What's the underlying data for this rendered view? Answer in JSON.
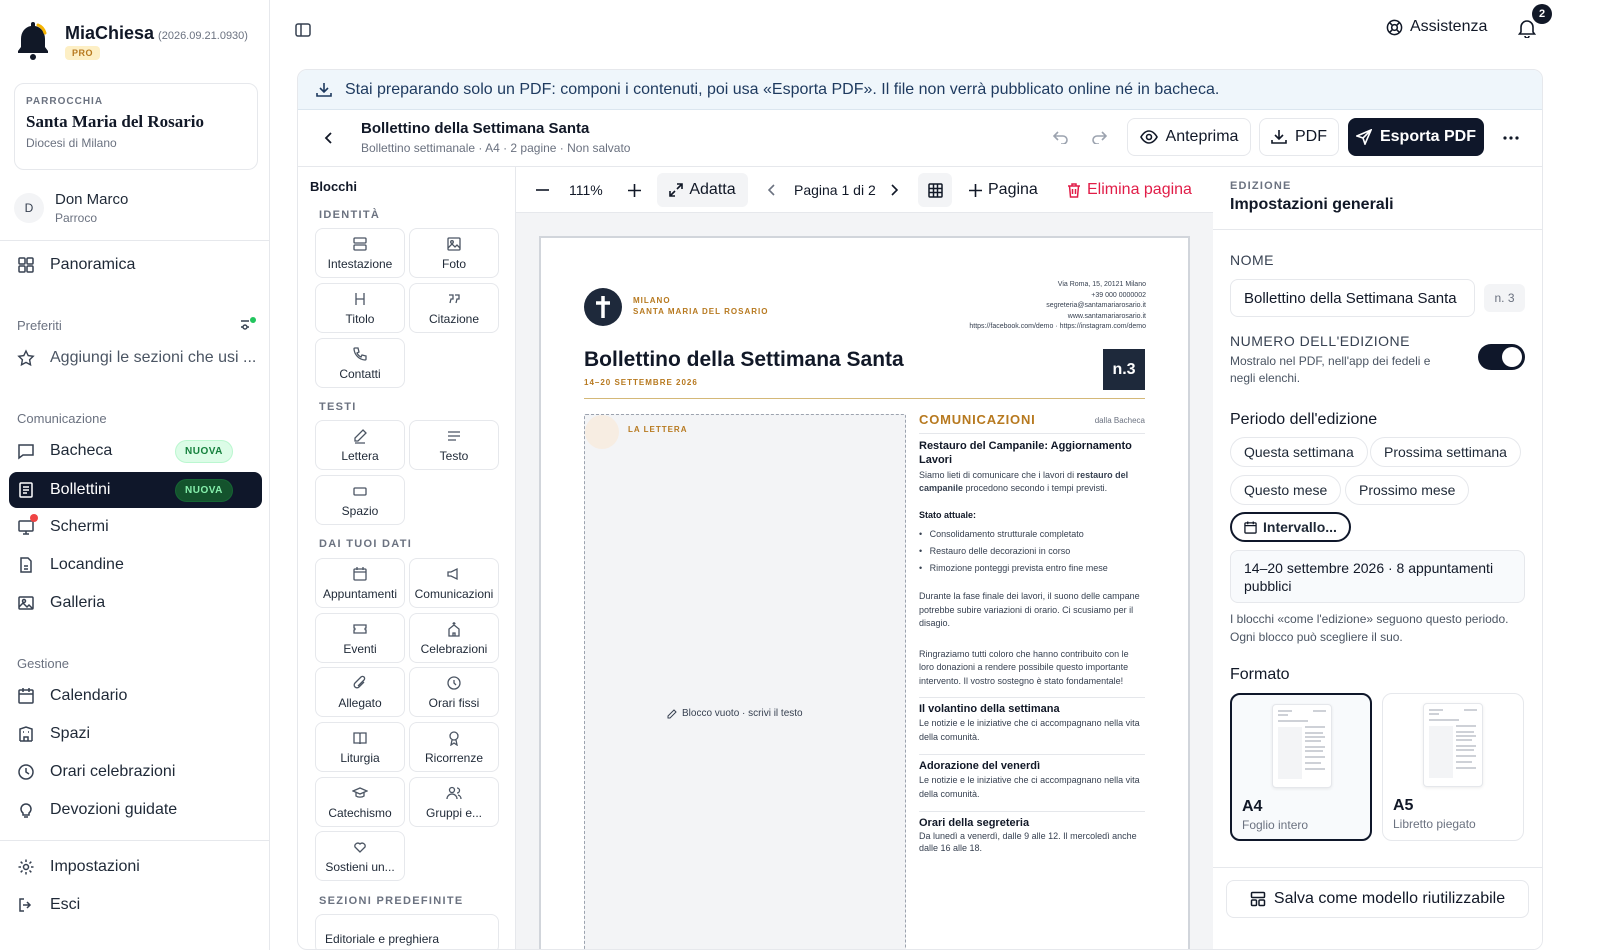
{
  "app": {
    "name": "MiaChiesa",
    "version": "(2026.09.21.0930)",
    "plan": "PRO"
  },
  "parish": {
    "kicker": "PARROCCHIA",
    "name": "Santa Maria del Rosario",
    "diocese": "Diocesi di Milano"
  },
  "user": {
    "initial": "D",
    "name": "Don Marco",
    "role": "Parroco"
  },
  "nav": {
    "overview": "Panoramica",
    "favorites_label": "Preferiti",
    "favorites_add": "Aggiungi le sezioni che usi ...",
    "comm_label": "Comunicazione",
    "comm_items": [
      {
        "label": "Bacheca",
        "badge": "NUOVA"
      },
      {
        "label": "Bollettini",
        "badge": "NUOVA"
      },
      {
        "label": "Schermi"
      },
      {
        "label": "Locandine"
      },
      {
        "label": "Galleria"
      }
    ],
    "mgmt_label": "Gestione",
    "mgmt_items": [
      "Calendario",
      "Spazi",
      "Orari celebrazioni",
      "Devozioni guidate"
    ],
    "settings": "Impostazioni",
    "logout": "Esci"
  },
  "topbar": {
    "help": "Assistenza",
    "notifications": "2"
  },
  "banner": "Stai preparando solo un PDF: componi i contenuti, poi usa «Esporta PDF». Il file non verrà pubblicato online né in bacheca.",
  "editor": {
    "title": "Bollettino della Settimana Santa",
    "meta": "Bollettino settimanale  ·  A4  ·  2 pagine  ·  Non salvato",
    "preview": "Anteprima",
    "pdf": "PDF",
    "export": "Esporta PDF"
  },
  "blocks": {
    "title": "Blocchi",
    "identity_label": "IDENTITÀ",
    "identity": [
      "Intestazione",
      "Foto",
      "Titolo",
      "Citazione",
      "Contatti"
    ],
    "texts_label": "TESTI",
    "texts": [
      "Lettera",
      "Testo",
      "Spazio"
    ],
    "data_label": "DAI TUOI DATI",
    "data": [
      "Appuntamenti",
      "Comunicazioni",
      "Eventi",
      "Celebrazioni",
      "Allegato",
      "Orari fissi",
      "Liturgia",
      "Ricorrenze",
      "Catechismo",
      "Gruppi e...",
      "Sostieni un..."
    ],
    "predef_label": "SEZIONI PREDEFINITE",
    "predef_first": "Editoriale e preghiera"
  },
  "canvas_toolbar": {
    "zoom": "111%",
    "fit": "Adatta",
    "page": "Pagina 1 di 2",
    "add_page": "Pagina",
    "delete_page": "Elimina pagina"
  },
  "document": {
    "org_city": "MILANO",
    "org_name": "SANTA MARIA DEL ROSARIO",
    "contact_lines": [
      "Via Roma, 15, 20121 Milano",
      "+39 000 0000002",
      "segreteria@santamariarosario.it",
      "www.santamariarosario.it",
      "https://facebook.com/demo · https://instagram.com/demo"
    ],
    "title": "Bollettino della Settimana Santa",
    "dates": "14–20 SETTEMBRE 2026",
    "number": "n.3",
    "letter_label": "LA LETTERA",
    "empty_block": "Blocco vuoto · scrivi il testo",
    "comm_title": "COMUNICAZIONI",
    "comm_source": "dalla Bacheca",
    "news1_title": "Restauro del Campanile: Aggiornamento Lavori",
    "news1_p1a": "Siamo lieti di comunicare che i lavori di ",
    "news1_p1b": "restauro del campanile",
    "news1_p1c": " procedono secondo i tempi previsti.",
    "status_label": "Stato attuale:",
    "status_items": [
      "Consolidamento strutturale completato",
      "Restauro delle decorazioni in corso",
      "Rimozione ponteggi prevista entro fine mese"
    ],
    "news1_p2": "Durante la fase finale dei lavori, il suono delle campane potrebbe subire variazioni di orario. Ci scusiamo per il disagio.",
    "news1_p3": "Ringraziamo tutti coloro che hanno contribuito con le loro donazioni a rendere possibile questo importante intervento. Il vostro sostegno è stato fondamentale!",
    "news2_title": "Il volantino della settimana",
    "news2_text": "Le notizie e le iniziative che ci accompagnano nella vita della comunità.",
    "news3_title": "Adorazione del venerdì",
    "news3_text": "Le notizie e le iniziative che ci accompagnano nella vita della comunità.",
    "news4_title": "Orari della segreteria",
    "news4_text": "Da lunedì a venerdì, dalle 9 alle 12. Il mercoledì anche dalle 16 alle 18."
  },
  "settings": {
    "kicker": "EDIZIONE",
    "title": "Impostazioni generali",
    "name_label": "NOME",
    "name_value": "Bollettino della Settimana Santa",
    "name_number": "n. 3",
    "edition_label": "NUMERO DELL'EDIZIONE",
    "edition_help": "Mostralo nel PDF, nell'app dei fedeli e negli elenchi.",
    "edition_on": true,
    "period_label": "Periodo dell'edizione",
    "period_chips": [
      "Questa settimana",
      "Prossima settimana",
      "Questo mese",
      "Prossimo mese",
      "Intervallo..."
    ],
    "period_summary": "14–20 settembre 2026 · 8 appuntamenti pubblici",
    "period_help": "I blocchi «come l'edizione» seguono questo periodo. Ogni blocco può scegliere il suo.",
    "format_label": "Formato",
    "formats": [
      {
        "name": "A4",
        "desc": "Foglio intero",
        "selected": true
      },
      {
        "name": "A5",
        "desc": "Libretto piegato",
        "selected": false
      }
    ],
    "save_template": "Salva come modello riutilizzabile"
  },
  "colors": {
    "dark": "#0f172a",
    "accent_gold": "#b7791f",
    "danger": "#e11d48",
    "new_badge": "#15803d"
  }
}
